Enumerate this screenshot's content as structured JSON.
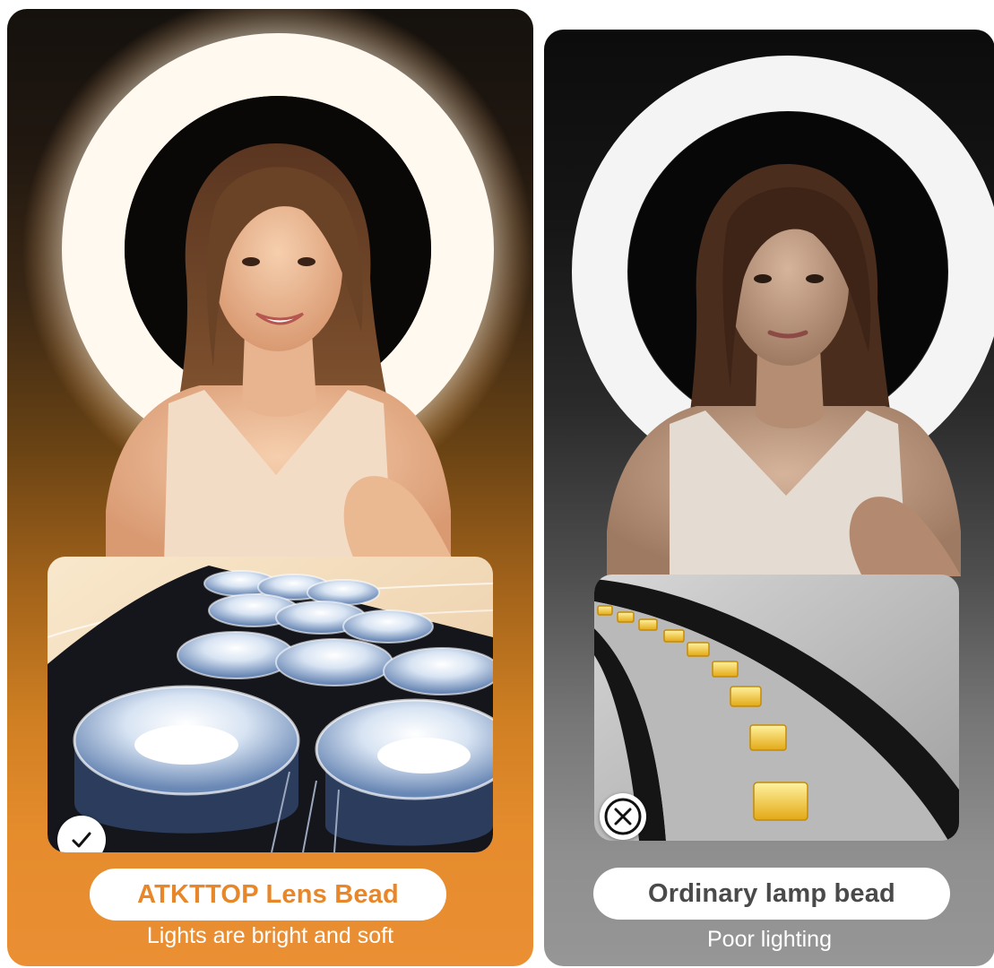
{
  "left": {
    "title": "ATKTTOP Lens Bead",
    "subtitle": "Lights are bright and soft",
    "status_icon": "check-icon",
    "title_color": "#e8862a",
    "ring_color": "#fff7ec"
  },
  "right": {
    "title": "Ordinary lamp bead",
    "subtitle": "Poor lighting",
    "status_icon": "close-icon",
    "title_color": "#4a4a4a",
    "ring_color": "#f6f6f6"
  }
}
